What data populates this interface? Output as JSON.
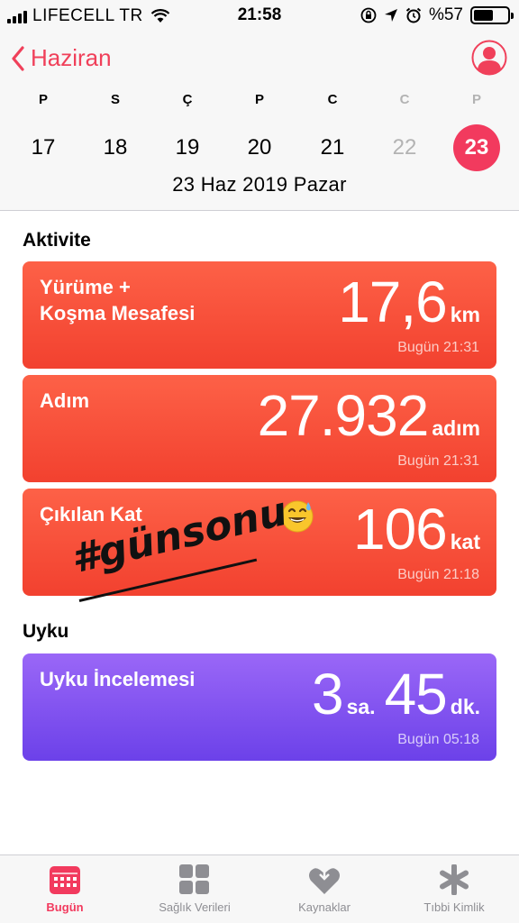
{
  "status_bar": {
    "carrier": "LIFECELL TR",
    "time": "21:58",
    "battery": "%57",
    "battery_level": 0.57
  },
  "header": {
    "back_label": "Haziran",
    "days": [
      {
        "letter": "P",
        "number": "17"
      },
      {
        "letter": "S",
        "number": "18"
      },
      {
        "letter": "Ç",
        "number": "19"
      },
      {
        "letter": "P",
        "number": "20"
      },
      {
        "letter": "C",
        "number": "21"
      },
      {
        "letter": "C",
        "number": "22"
      },
      {
        "letter": "P",
        "number": "23"
      }
    ],
    "full_date": "23 Haz 2019 Pazar"
  },
  "activity": {
    "title": "Aktivite",
    "cards": [
      {
        "label_line1": "Yürüme +",
        "label_line2": "Koşma Mesafesi",
        "value": "17,6",
        "unit": "km",
        "time": "Bugün 21:31"
      },
      {
        "label_line1": "Adım",
        "value": "27.932",
        "unit": "adım",
        "time": "Bugün 21:31"
      },
      {
        "label_line1": "Çıkılan Kat",
        "value": "106",
        "unit": "kat",
        "time": "Bugün 21:18"
      }
    ]
  },
  "overlay": {
    "hashtag": "#günsonu"
  },
  "sleep": {
    "title": "Uyku",
    "card": {
      "label": "Uyku İncelemesi",
      "hours": "3",
      "hours_unit": "sa.",
      "minutes": "45",
      "minutes_unit": "dk.",
      "time": "Bugün 05:18"
    }
  },
  "tabs": [
    {
      "label": "Bugün",
      "icon": "calendar-icon"
    },
    {
      "label": "Sağlık Verileri",
      "icon": "grid-icon"
    },
    {
      "label": "Kaynaklar",
      "icon": "heart-download-icon"
    },
    {
      "label": "Tıbbi Kimlik",
      "icon": "asterisk-icon"
    }
  ],
  "colors": {
    "accent": "#f23a5e",
    "activity_card": "#f85039",
    "sleep_card": "#8456f0"
  }
}
